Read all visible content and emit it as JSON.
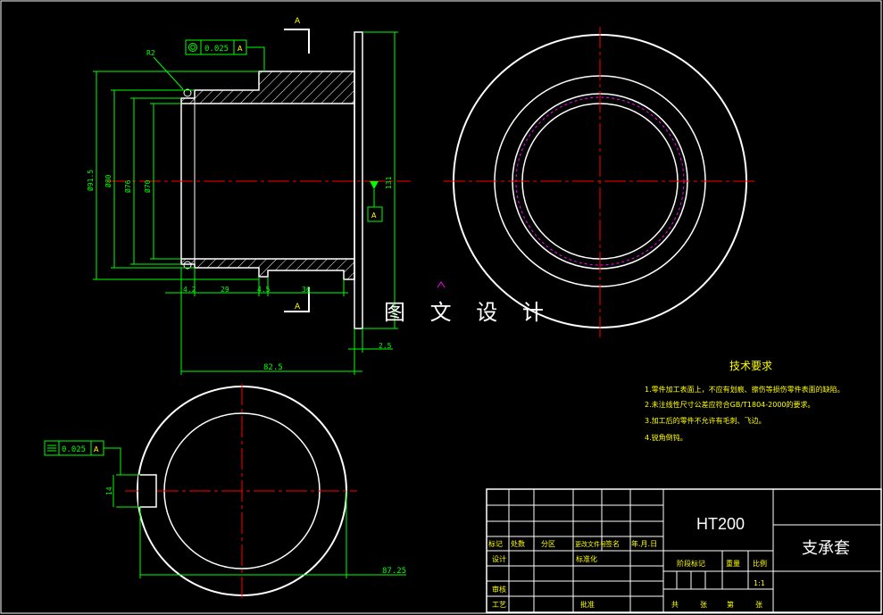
{
  "watermark": "图 文 设 计",
  "section_label": "A",
  "dims": {
    "r2": "R2",
    "tol_top": "0.025",
    "tol_bottom": "0.025",
    "d1": "Ø91.5",
    "d2": "Ø80",
    "d3": "Ø76",
    "d4": "Ø70",
    "h131": "131",
    "w4_2": "4.2",
    "w29": "29",
    "w4_5": "4.5",
    "w36": "36",
    "w2_5": "2.5",
    "w82_5": "82.5",
    "w87_25": "87.25",
    "h14": "14"
  },
  "requirements": {
    "title": "技术要求",
    "items": [
      "1.零件加工表面上，不应有划痕、擦伤等损伤零件表面的缺陷。",
      "2.未注线性尺寸公差应符合GB/T1804-2000的要求。",
      "3.加工后的零件不允许有毛刺、飞边。",
      "4.锐角倒钝。"
    ]
  },
  "title_block": {
    "material": "HT200",
    "part_name": "支承套",
    "scale": "1:1",
    "row_labels": [
      "标记",
      "处数",
      "分区",
      "更改文件号",
      "签名",
      "年.月.日"
    ],
    "design": "设计",
    "standardize": "标准化",
    "review": "审核",
    "process": "工艺",
    "approve": "批准",
    "stage_mark": "阶段标记",
    "weight": "重量",
    "ratio": "比例",
    "sheets": [
      "共",
      "张",
      "第",
      "张"
    ]
  }
}
